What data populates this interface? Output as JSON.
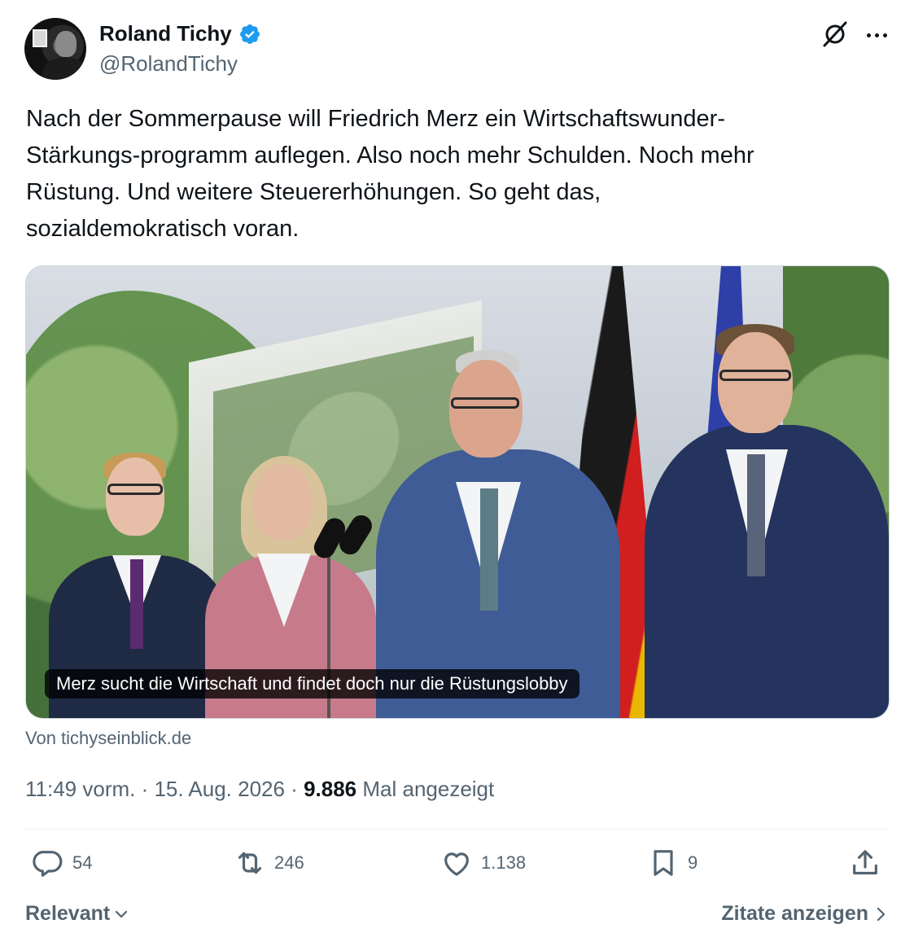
{
  "author": {
    "display_name": "Roland Tichy",
    "handle": "@RolandTichy",
    "verified_icon": "verified-badge-icon"
  },
  "tweet": {
    "text": "Nach der Sommerpause will Friedrich Merz ein Wirtschaftswunder-\nStärkungs-programm auflegen. Also noch mehr Schulden. Noch mehr\nRüstung. Und weitere Steuererhöhungen. So geht das,\nsozialdemokratisch voran."
  },
  "media": {
    "caption": "Merz sucht die Wirtschaft und findet doch nur die Rüstungslobby",
    "source": "Von tichyseinblick.de"
  },
  "meta": {
    "time": "11:49 vorm.",
    "sep1": " · ",
    "date": "15. Aug. 2026",
    "sep2": " · ",
    "views_count": "9.886",
    "views_label": " Mal angezeigt"
  },
  "actions": {
    "replies": "54",
    "reposts": "246",
    "likes": "1.138",
    "bookmarks": "9"
  },
  "footer": {
    "sort_label": "Relevant",
    "quotes_label": "Zitate anzeigen"
  },
  "colors": {
    "text": "#0f1419",
    "muted": "#536471",
    "verified": "#1d9bf0"
  }
}
